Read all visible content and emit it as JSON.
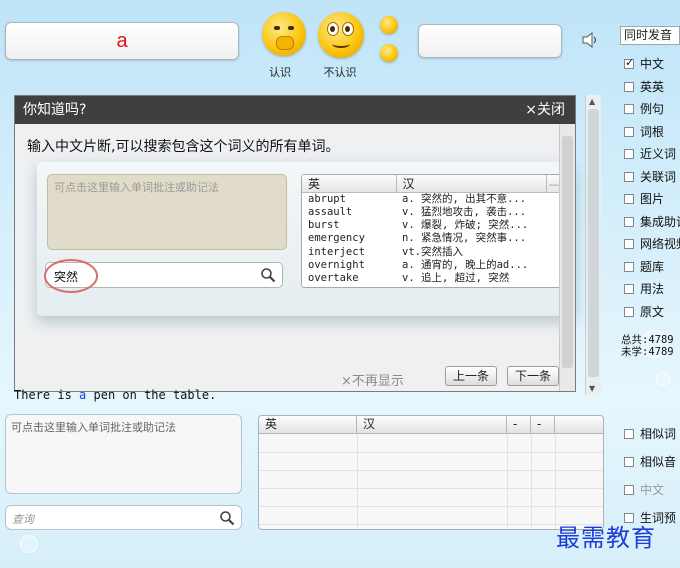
{
  "current_word": "a",
  "faces": {
    "know_label": "认识",
    "unknown_label": "不认识"
  },
  "modal": {
    "title": "你知道吗?",
    "close_label": "×关闭",
    "tip": "输入中文片断,可以搜索包含这个词义的所有单词。",
    "note_placeholder": "可点击这里输入单词批注或助记法",
    "search_value": "突然",
    "table": {
      "headers": [
        "英",
        "汉",
        "—"
      ],
      "rows": [
        [
          "abrupt",
          "a. 突然的, 出其不意..."
        ],
        [
          "assault",
          "v. 猛烈地攻击, 袭击..."
        ],
        [
          "burst",
          "v. 爆裂, 炸破; 突然..."
        ],
        [
          "emergency",
          "n. 紧急情况, 突然事..."
        ],
        [
          "interject",
          "vt.突然插入"
        ],
        [
          "overnight",
          "a. 通宵的, 晚上的ad..."
        ],
        [
          "overtake",
          "v. 追上, 超过, 突然"
        ]
      ]
    },
    "dismiss_label": "×不再显示",
    "prev_label": "上一条",
    "next_label": "下一条"
  },
  "sentence": {
    "before": "There is ",
    "highlight": "a",
    "after": " pen on the table."
  },
  "note_box_placeholder": "可点击这里输入单词批注或助记法",
  "query_placeholder": "查询",
  "bottom_table": {
    "headers": [
      "英",
      "汉",
      "-",
      "-"
    ]
  },
  "mode_select": "同时发音",
  "options": [
    {
      "label": "中文",
      "checked": true
    },
    {
      "label": "英英",
      "checked": false
    },
    {
      "label": "例句",
      "checked": false
    },
    {
      "label": "词根",
      "checked": false
    },
    {
      "label": "近义词",
      "checked": false
    },
    {
      "label": "关联词",
      "checked": false
    },
    {
      "label": "图片",
      "checked": false
    },
    {
      "label": "集成助记",
      "checked": false
    },
    {
      "label": "网络视频",
      "checked": false
    },
    {
      "label": "题库",
      "checked": false
    },
    {
      "label": "用法",
      "checked": false
    },
    {
      "label": "原文",
      "checked": false
    }
  ],
  "stats": {
    "total": "总共:4789",
    "unlearned": "未学:4789"
  },
  "lower_options": [
    {
      "label": "相似词",
      "checked": false
    },
    {
      "label": "相似音",
      "checked": false
    },
    {
      "label": "中文",
      "checked": false,
      "disabled": true
    },
    {
      "label": "生词预",
      "checked": false
    }
  ],
  "watermark": "最需教育",
  "colors": {
    "word": "#e0141e",
    "highlight": "#1a3fd6",
    "watermark": "#1f3bd8",
    "modal_title_bg": "#3f3f3f"
  }
}
